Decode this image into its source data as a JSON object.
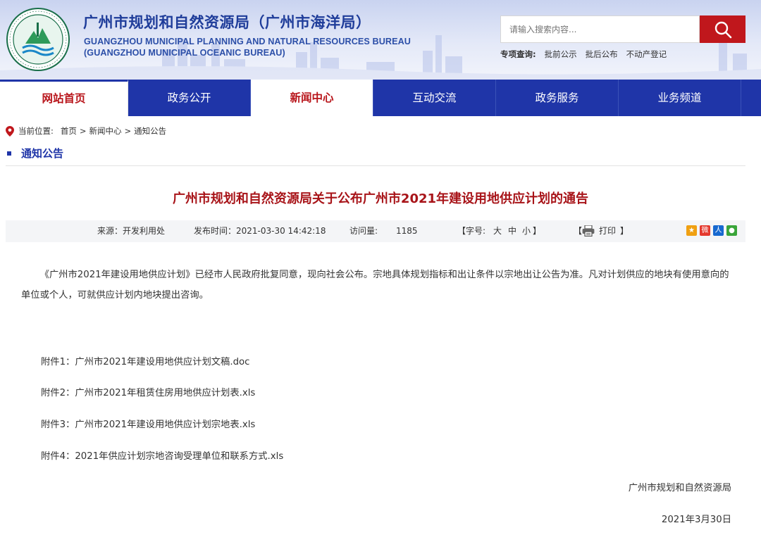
{
  "site": {
    "title_cn": "广州市规划和自然资源局（广州市海洋局）",
    "title_en_1": "GUANGZHOU MUNICIPAL PLANNING AND NATURAL RESOURCES BUREAU",
    "title_en_2": "(GUANGZHOU MUNICIPAL OCEANIC BUREAU)",
    "logo_icon": "bureau-seal-logo"
  },
  "search": {
    "placeholder": "请输入搜索内容...",
    "button_icon": "search-icon",
    "button_color": "#c0171c"
  },
  "quick_links": {
    "label": "专项查询:",
    "items": [
      "批前公示",
      "批后公布",
      "不动产登记"
    ]
  },
  "nav": {
    "items": [
      {
        "label": "网站首页"
      },
      {
        "label": "政务公开"
      },
      {
        "label": "新闻中心"
      },
      {
        "label": "互动交流"
      },
      {
        "label": "政务服务"
      },
      {
        "label": "业务频道"
      }
    ],
    "active_index": 2,
    "color": "#1f35a8"
  },
  "breadcrumb": {
    "icon": "location-pin-icon",
    "prefix": "当前位置:",
    "items": [
      "首页",
      "新闻中心",
      "通知公告"
    ],
    "sep": ">"
  },
  "section": {
    "title": "通知公告"
  },
  "article": {
    "title": "广州市规划和自然资源局关于公布广州市2021年建设用地供应计划的通告",
    "meta": {
      "source": "来源：开发利用处",
      "publish_time": "发布时间：2021-03-30 14:42:18",
      "visits_label": "访问量:",
      "visits": "1185",
      "font_size_label": "【字号:",
      "font_large": "大",
      "font_medium": "中",
      "font_small": "小",
      "font_close": "】",
      "print_open": "【",
      "print_label": "打印",
      "print_close": "】",
      "print_icon": "printer-icon",
      "share_icons": [
        "qzone-icon",
        "weibo-icon",
        "renren-icon",
        "wechat-icon"
      ]
    },
    "body": "《广州市2021年建设用地供应计划》已经市人民政府批复同意，现向社会公布。宗地具体规划指标和出让条件以宗地出让公告为准。凡对计划供应的地块有使用意向的单位或个人，可就供应计划内地块提出咨询。",
    "attachments": [
      "附件1：广州市2021年建设用地供应计划文稿.doc",
      "附件2：广州市2021年租赁住房用地供应计划表.xls",
      "附件3：广州市2021年建设用地供应计划宗地表.xls",
      "附件4：2021年供应计划宗地咨询受理单位和联系方式.xls"
    ],
    "signature": "广州市规划和自然资源局",
    "date": "2021年3月30日"
  }
}
